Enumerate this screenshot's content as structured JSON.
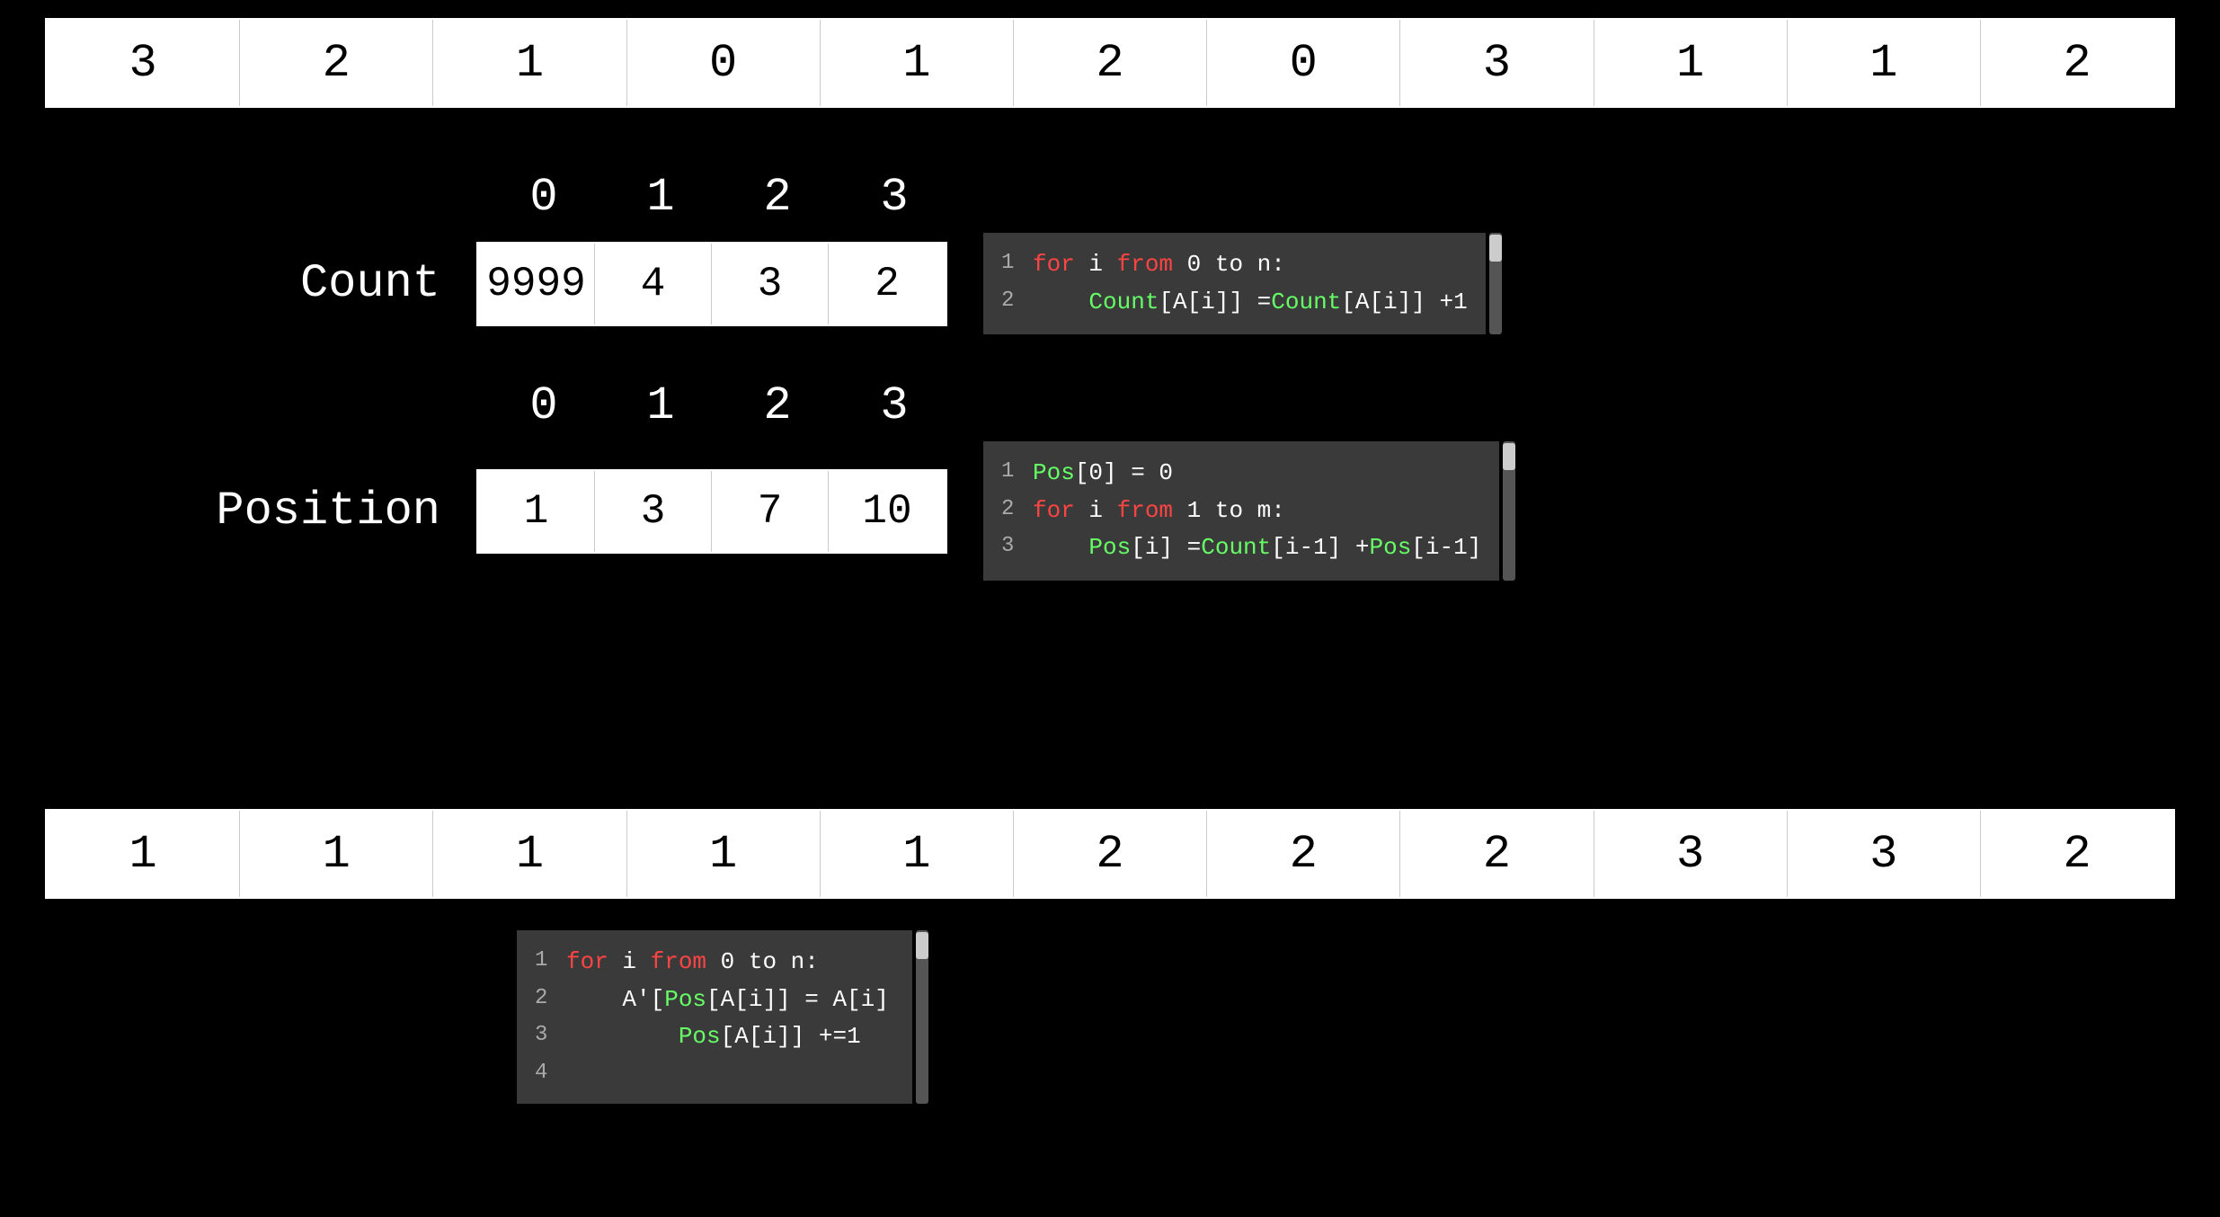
{
  "top_array": {
    "values": [
      "3",
      "2",
      "1",
      "0",
      "1",
      "2",
      "0",
      "3",
      "1",
      "1",
      "2"
    ]
  },
  "count_section": {
    "label": "Count",
    "indices": [
      "0",
      "1",
      "2",
      "3"
    ],
    "values": [
      "9999",
      "4",
      "3",
      "2"
    ],
    "code": [
      {
        "num": "1",
        "text": "for i from 0 to n:"
      },
      {
        "num": "2",
        "text": "    Count[A[i]] =Count[A[i]] +1"
      }
    ]
  },
  "position_section": {
    "label": "Position",
    "indices": [
      "0",
      "1",
      "2",
      "3"
    ],
    "values": [
      "1",
      "3",
      "7",
      "10"
    ],
    "code": [
      {
        "num": "1",
        "text": "Pos[0] = 0"
      },
      {
        "num": "2",
        "text": "for i from 1 to m:"
      },
      {
        "num": "3",
        "text": "    Pos[i] =Count[i-1] +Pos[i-1]"
      }
    ]
  },
  "bottom_array": {
    "values": [
      "1",
      "1",
      "1",
      "1",
      "1",
      "2",
      "2",
      "2",
      "3",
      "3",
      "2"
    ]
  },
  "bottom_code": [
    {
      "num": "1",
      "text": "for i from 0 to n:"
    },
    {
      "num": "2",
      "text": "    A'[Pos[A[i]] = A[i]"
    },
    {
      "num": "3",
      "text": "        Pos[A[i]] +=1"
    },
    {
      "num": "4",
      "text": ""
    }
  ]
}
